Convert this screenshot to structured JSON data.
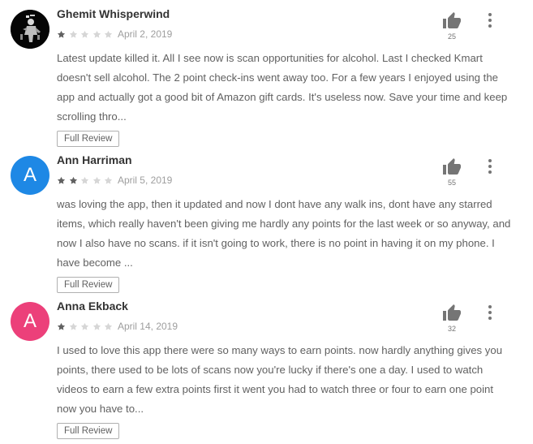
{
  "reviews": [
    {
      "name": "Ghemit Whisperwind",
      "avatar_type": "photo",
      "avatar_letter": "",
      "avatar_color": "#050505",
      "rating": 1,
      "date": "April 2, 2019",
      "helpful_count": "25",
      "text": "Latest update killed it. All I see now is scan opportunities for alcohol. Last I checked Kmart doesn't sell alcohol. The 2 point check-ins went away too. For a few years I enjoyed using the app and actually got a good bit of Amazon gift cards. It's useless now. Save your time and keep scrolling thro...",
      "button_label": "Full Review"
    },
    {
      "name": "Ann Harriman",
      "avatar_type": "letter",
      "avatar_letter": "A",
      "avatar_color": "#1e88e5",
      "rating": 2,
      "date": "April 5, 2019",
      "helpful_count": "55",
      "text": "was loving the app, then it updated and now I dont have any walk ins, dont have any starred items, which really haven't been giving me hardly any points for the last week or so anyway, and now I also have no scans. if it isn't going to work, there is no point in having it on my phone. I have become ...",
      "button_label": "Full Review"
    },
    {
      "name": "Anna Ekback",
      "avatar_type": "letter",
      "avatar_letter": "A",
      "avatar_color": "#ec407a",
      "rating": 1,
      "date": "April 14, 2019",
      "helpful_count": "32",
      "text": "I used to love this app there were so many ways to earn points. now hardly anything gives you points, there used to be lots of scans now you're lucky if there's one a day. I used to watch videos to earn a few extra points first it went you had to watch three or four to earn one point now you have to...",
      "button_label": "Full Review"
    }
  ],
  "colors": {
    "star_filled": "#616161",
    "star_empty": "#d6d6d6",
    "thumb_icon": "#757575",
    "menu_icon": "#757575"
  }
}
